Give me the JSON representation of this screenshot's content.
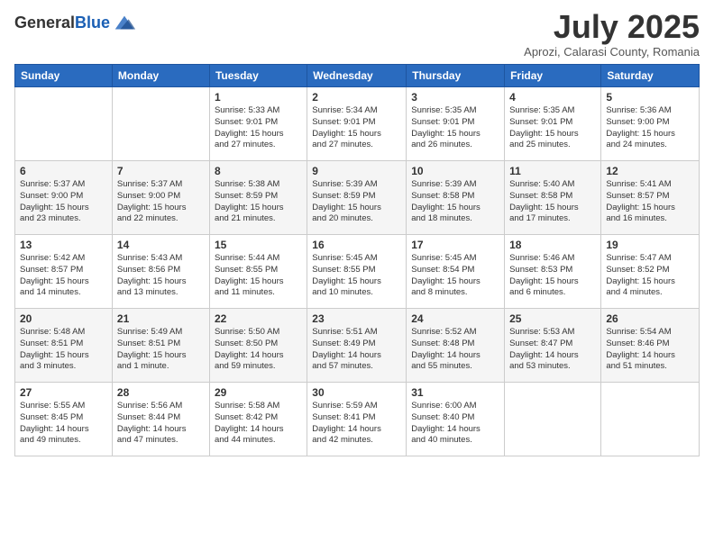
{
  "header": {
    "logo_general": "General",
    "logo_blue": "Blue",
    "month_title": "July 2025",
    "location": "Aprozi, Calarasi County, Romania"
  },
  "weekdays": [
    "Sunday",
    "Monday",
    "Tuesday",
    "Wednesday",
    "Thursday",
    "Friday",
    "Saturday"
  ],
  "weeks": [
    [
      {
        "day": "",
        "info": ""
      },
      {
        "day": "",
        "info": ""
      },
      {
        "day": "1",
        "info": "Sunrise: 5:33 AM\nSunset: 9:01 PM\nDaylight: 15 hours\nand 27 minutes."
      },
      {
        "day": "2",
        "info": "Sunrise: 5:34 AM\nSunset: 9:01 PM\nDaylight: 15 hours\nand 27 minutes."
      },
      {
        "day": "3",
        "info": "Sunrise: 5:35 AM\nSunset: 9:01 PM\nDaylight: 15 hours\nand 26 minutes."
      },
      {
        "day": "4",
        "info": "Sunrise: 5:35 AM\nSunset: 9:01 PM\nDaylight: 15 hours\nand 25 minutes."
      },
      {
        "day": "5",
        "info": "Sunrise: 5:36 AM\nSunset: 9:00 PM\nDaylight: 15 hours\nand 24 minutes."
      }
    ],
    [
      {
        "day": "6",
        "info": "Sunrise: 5:37 AM\nSunset: 9:00 PM\nDaylight: 15 hours\nand 23 minutes."
      },
      {
        "day": "7",
        "info": "Sunrise: 5:37 AM\nSunset: 9:00 PM\nDaylight: 15 hours\nand 22 minutes."
      },
      {
        "day": "8",
        "info": "Sunrise: 5:38 AM\nSunset: 8:59 PM\nDaylight: 15 hours\nand 21 minutes."
      },
      {
        "day": "9",
        "info": "Sunrise: 5:39 AM\nSunset: 8:59 PM\nDaylight: 15 hours\nand 20 minutes."
      },
      {
        "day": "10",
        "info": "Sunrise: 5:39 AM\nSunset: 8:58 PM\nDaylight: 15 hours\nand 18 minutes."
      },
      {
        "day": "11",
        "info": "Sunrise: 5:40 AM\nSunset: 8:58 PM\nDaylight: 15 hours\nand 17 minutes."
      },
      {
        "day": "12",
        "info": "Sunrise: 5:41 AM\nSunset: 8:57 PM\nDaylight: 15 hours\nand 16 minutes."
      }
    ],
    [
      {
        "day": "13",
        "info": "Sunrise: 5:42 AM\nSunset: 8:57 PM\nDaylight: 15 hours\nand 14 minutes."
      },
      {
        "day": "14",
        "info": "Sunrise: 5:43 AM\nSunset: 8:56 PM\nDaylight: 15 hours\nand 13 minutes."
      },
      {
        "day": "15",
        "info": "Sunrise: 5:44 AM\nSunset: 8:55 PM\nDaylight: 15 hours\nand 11 minutes."
      },
      {
        "day": "16",
        "info": "Sunrise: 5:45 AM\nSunset: 8:55 PM\nDaylight: 15 hours\nand 10 minutes."
      },
      {
        "day": "17",
        "info": "Sunrise: 5:45 AM\nSunset: 8:54 PM\nDaylight: 15 hours\nand 8 minutes."
      },
      {
        "day": "18",
        "info": "Sunrise: 5:46 AM\nSunset: 8:53 PM\nDaylight: 15 hours\nand 6 minutes."
      },
      {
        "day": "19",
        "info": "Sunrise: 5:47 AM\nSunset: 8:52 PM\nDaylight: 15 hours\nand 4 minutes."
      }
    ],
    [
      {
        "day": "20",
        "info": "Sunrise: 5:48 AM\nSunset: 8:51 PM\nDaylight: 15 hours\nand 3 minutes."
      },
      {
        "day": "21",
        "info": "Sunrise: 5:49 AM\nSunset: 8:51 PM\nDaylight: 15 hours\nand 1 minute."
      },
      {
        "day": "22",
        "info": "Sunrise: 5:50 AM\nSunset: 8:50 PM\nDaylight: 14 hours\nand 59 minutes."
      },
      {
        "day": "23",
        "info": "Sunrise: 5:51 AM\nSunset: 8:49 PM\nDaylight: 14 hours\nand 57 minutes."
      },
      {
        "day": "24",
        "info": "Sunrise: 5:52 AM\nSunset: 8:48 PM\nDaylight: 14 hours\nand 55 minutes."
      },
      {
        "day": "25",
        "info": "Sunrise: 5:53 AM\nSunset: 8:47 PM\nDaylight: 14 hours\nand 53 minutes."
      },
      {
        "day": "26",
        "info": "Sunrise: 5:54 AM\nSunset: 8:46 PM\nDaylight: 14 hours\nand 51 minutes."
      }
    ],
    [
      {
        "day": "27",
        "info": "Sunrise: 5:55 AM\nSunset: 8:45 PM\nDaylight: 14 hours\nand 49 minutes."
      },
      {
        "day": "28",
        "info": "Sunrise: 5:56 AM\nSunset: 8:44 PM\nDaylight: 14 hours\nand 47 minutes."
      },
      {
        "day": "29",
        "info": "Sunrise: 5:58 AM\nSunset: 8:42 PM\nDaylight: 14 hours\nand 44 minutes."
      },
      {
        "day": "30",
        "info": "Sunrise: 5:59 AM\nSunset: 8:41 PM\nDaylight: 14 hours\nand 42 minutes."
      },
      {
        "day": "31",
        "info": "Sunrise: 6:00 AM\nSunset: 8:40 PM\nDaylight: 14 hours\nand 40 minutes."
      },
      {
        "day": "",
        "info": ""
      },
      {
        "day": "",
        "info": ""
      }
    ]
  ]
}
